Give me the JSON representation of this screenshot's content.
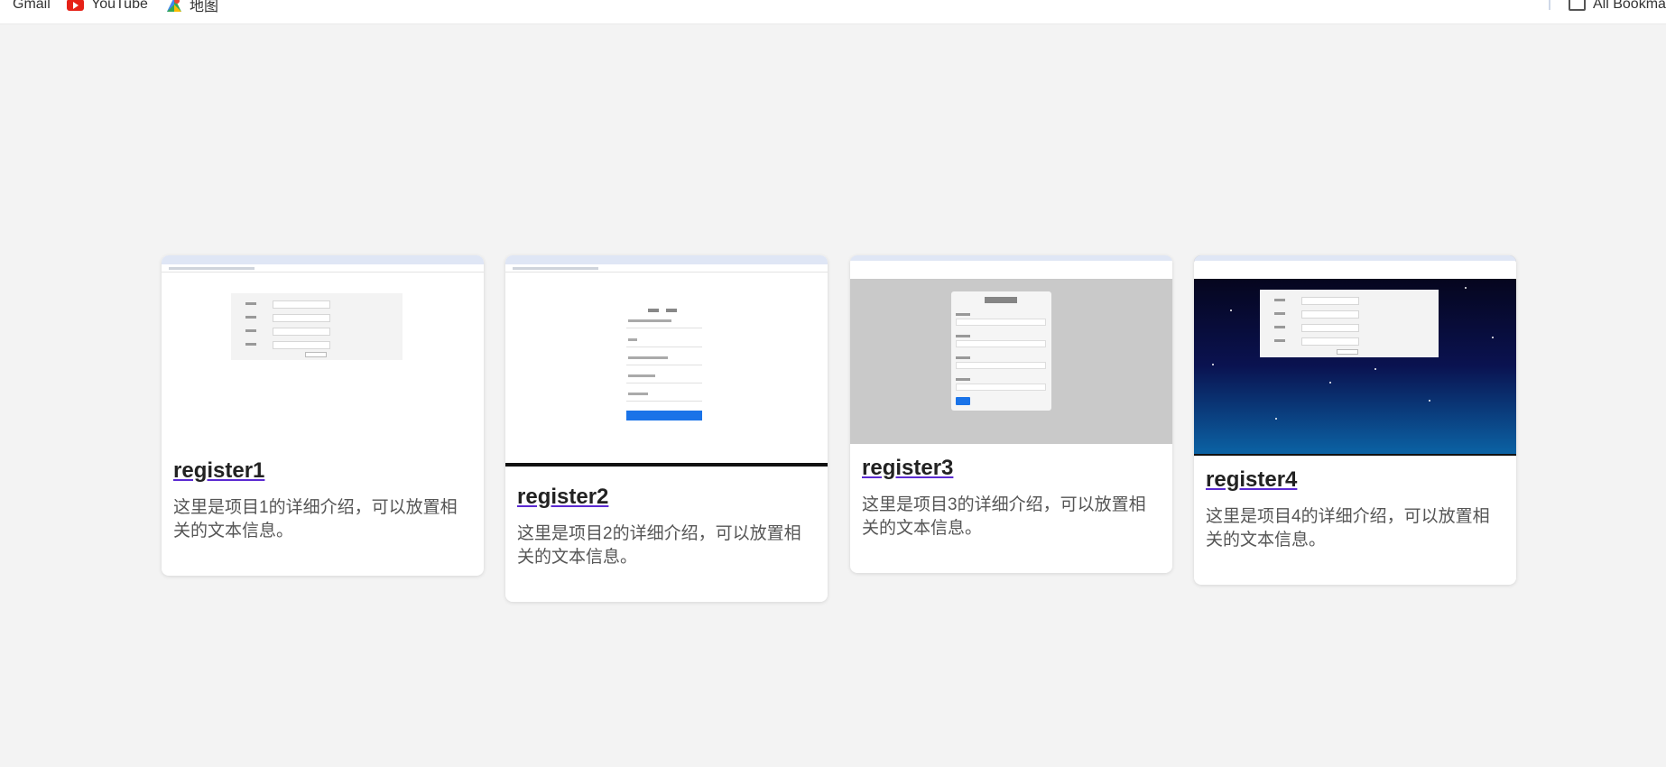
{
  "bookmarks": {
    "items": [
      {
        "label": "Gmail",
        "icon": "gmail-icon"
      },
      {
        "label": "YouTube",
        "icon": "youtube-icon"
      },
      {
        "label": "地图",
        "icon": "maps-icon"
      }
    ],
    "all_bookmarks": "All Bookma"
  },
  "cards": [
    {
      "title": "register1",
      "description": "这里是项目1的详细介绍，可以放置相关的文本信息。"
    },
    {
      "title": "register2",
      "description": "这里是项目2的详细介绍，可以放置相关的文本信息。"
    },
    {
      "title": "register3",
      "description": "这里是项目3的详细介绍，可以放置相关的文本信息。"
    },
    {
      "title": "register4",
      "description": "这里是项目4的详细介绍，可以放置相关的文本信息。"
    }
  ],
  "colors": {
    "background": "#f3f3f3",
    "card": "#ffffff",
    "link_underline": "#5b2ad1",
    "accent_button": "#1a73e8"
  }
}
